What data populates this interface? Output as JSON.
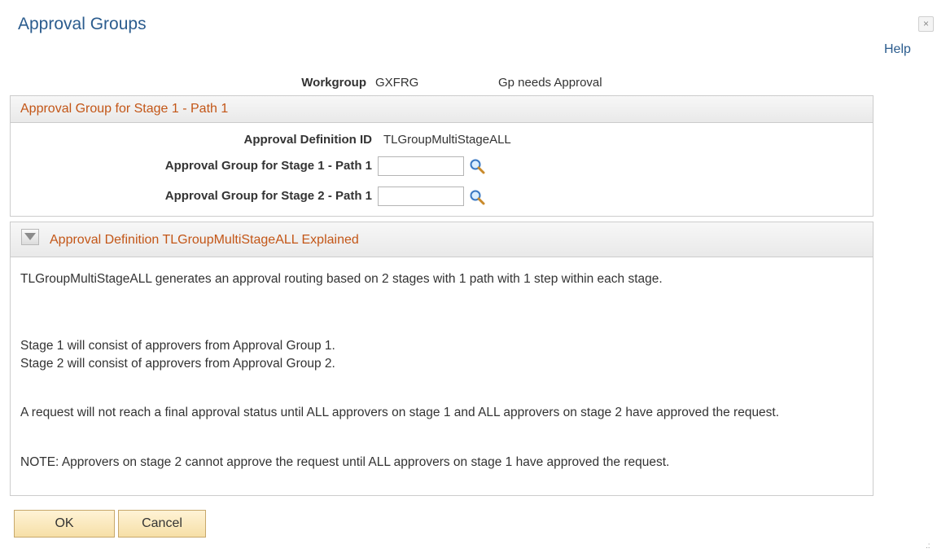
{
  "dialog": {
    "title": "Approval Groups",
    "close_glyph": "×",
    "help_label": "Help"
  },
  "workgroup": {
    "label": "Workgroup",
    "value": "GXFRG",
    "description": "Gp needs Approval"
  },
  "stage_section": {
    "header": "Approval Group for Stage 1 - Path 1",
    "def_id_label": "Approval Definition ID",
    "def_id_value": "TLGroupMultiStageALL",
    "fields": [
      {
        "label": "Approval Group for Stage 1 - Path 1",
        "value": "",
        "lookup_icon": "magnifier-icon"
      },
      {
        "label": "Approval Group for Stage 2 - Path 1",
        "value": "",
        "lookup_icon": "magnifier-icon"
      }
    ]
  },
  "explained_section": {
    "header": "Approval Definition TLGroupMultiStageALL Explained",
    "paragraphs": [
      "TLGroupMultiStageALL generates an approval routing based on 2 stages with 1 path with 1 step within each stage.",
      "Stage 1 will consist of approvers from Approval Group 1.",
      "Stage 2 will consist of approvers from Approval Group 2.",
      "A request will not reach a final approval status until ALL approvers on stage 1 and ALL approvers on stage 2 have approved the request.",
      "NOTE:  Approvers on stage 2 cannot approve the request until ALL approvers on stage 1 have approved the request."
    ]
  },
  "buttons": {
    "ok": "OK",
    "cancel": "Cancel"
  },
  "colors": {
    "title": "#2b5c8e",
    "section_header_text": "#c35617",
    "button_fill": "#f6dfa7"
  }
}
